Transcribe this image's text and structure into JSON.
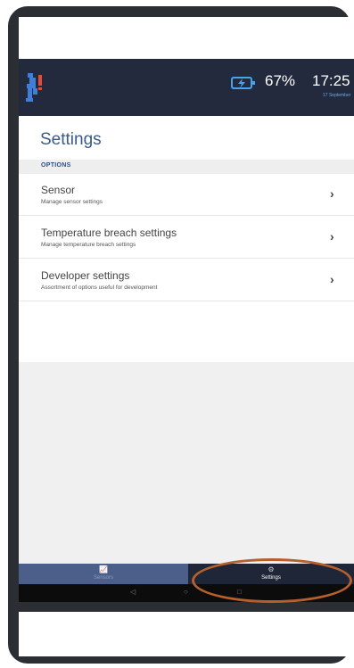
{
  "status_bar": {
    "battery_percent": "67%",
    "time": "17:25",
    "date": "17 September"
  },
  "page": {
    "title": "Settings",
    "section_header": "OPTIONS"
  },
  "settings_items": [
    {
      "title": "Sensor",
      "subtitle": "Manage sensor settings"
    },
    {
      "title": "Temperature breach settings",
      "subtitle": "Manage temperature breach settings"
    },
    {
      "title": "Developer settings",
      "subtitle": "Assortment of options useful for development"
    }
  ],
  "bottom_nav": {
    "sensors_label": "Sensors",
    "settings_label": "Settings"
  },
  "system_nav": {
    "back": "◁",
    "home": "○",
    "recents": "□"
  },
  "colors": {
    "status_bar": "#232a3d",
    "title": "#3b5a86",
    "nav_inactive": "#4b5f8a",
    "nav_active": "#1f2637",
    "highlight_ring": "#b5602d",
    "battery": "#4aa3e8"
  },
  "icons": [
    "app-logo-icon",
    "battery-charging-icon",
    "chevron-right-icon",
    "chart-icon",
    "gear-icon"
  ]
}
